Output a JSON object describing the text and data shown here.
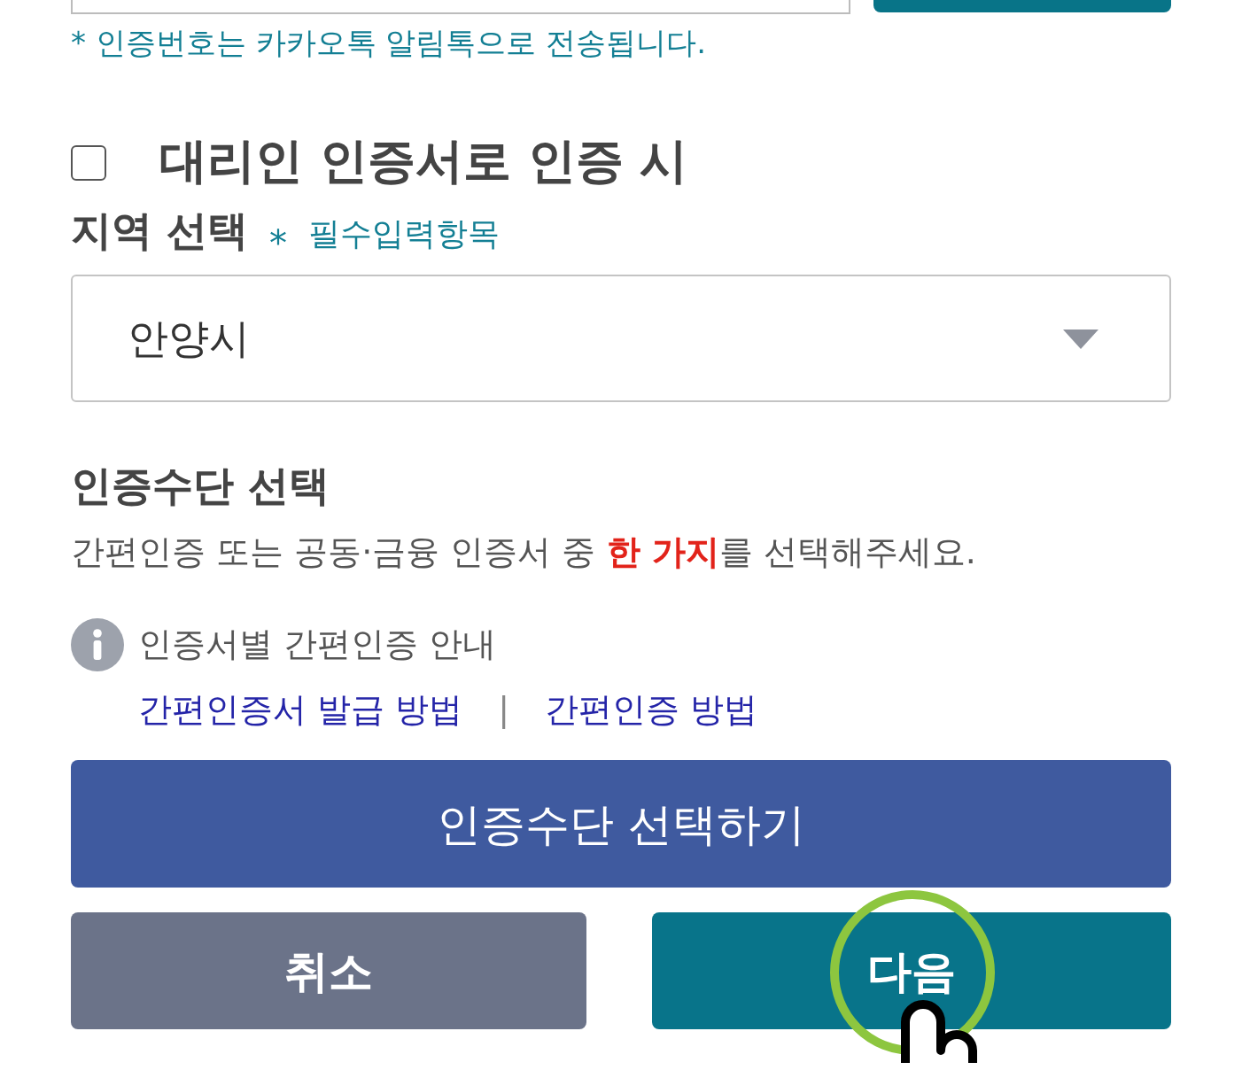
{
  "hint": "* 인증번호는 카카오톡 알림톡으로 전송됩니다.",
  "proxy_checkbox": {
    "label": "대리인 인증서로 인증 시",
    "checked": false
  },
  "region": {
    "label": "지역 선택",
    "required_mark": "*",
    "required_note": "필수입력항목",
    "value": "안양시"
  },
  "auth_method": {
    "title": "인증수단 선택",
    "description": "간편인증 또는 공동·금융 인증서 중 **한 가지**를 선택해주세요.",
    "info": "인증서별 간편인증 안내",
    "links": [
      "간편인증서 발급 방법",
      "간편인증 방법"
    ],
    "separator": "|",
    "select_button": "인증수단 선택하기"
  },
  "buttons": [
    {
      "label": "취소",
      "kind": "cancel",
      "tapped": false
    },
    {
      "label": "다음",
      "kind": "next",
      "tapped": true
    }
  ]
}
